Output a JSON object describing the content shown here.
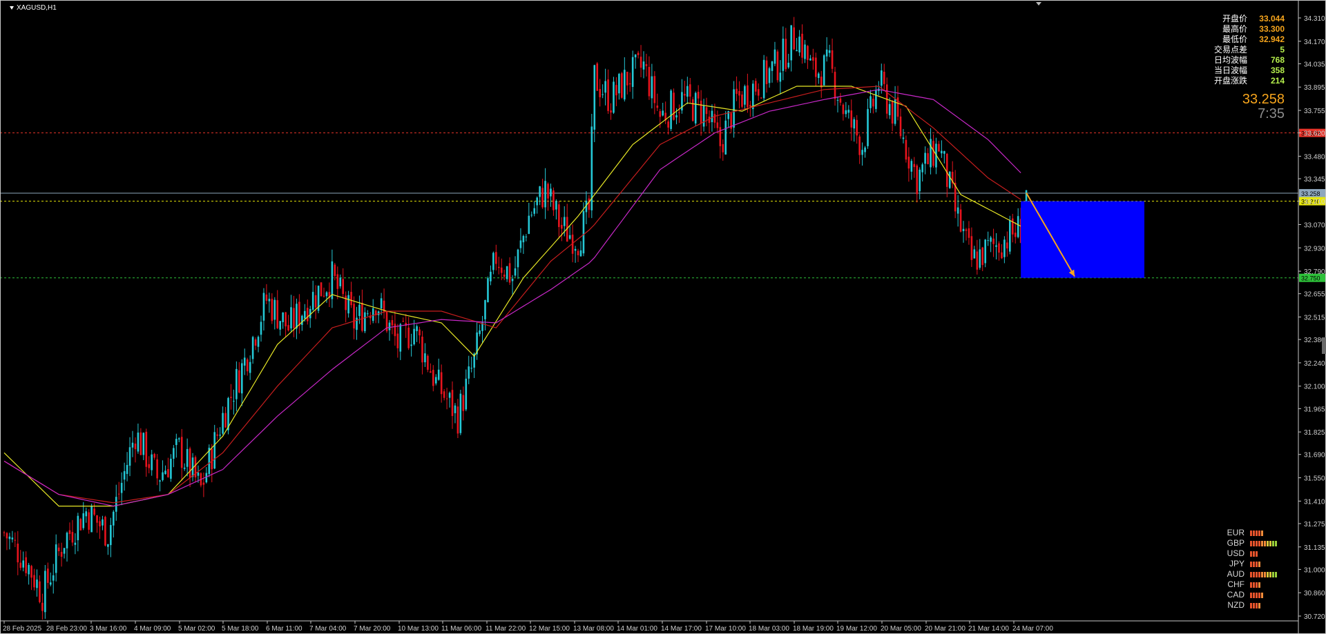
{
  "app": {
    "symbol_title": "XAGUSD,H1"
  },
  "info_panel": {
    "rows": [
      {
        "label": "开盘价",
        "value": "33.044"
      },
      {
        "label": "最高价",
        "value": "33.300"
      },
      {
        "label": "最低价",
        "value": "32.942"
      },
      {
        "label": "交易点差",
        "value": "5"
      },
      {
        "label": "日均波幅",
        "value": "768"
      },
      {
        "label": "当日波幅",
        "value": "358"
      },
      {
        "label": "开盘涨跌",
        "value": "214"
      }
    ],
    "current_price": "33.258",
    "countdown": "7:35"
  },
  "currency_strength": [
    {
      "currency": "EUR",
      "levels": 5,
      "colors": [
        "#e8542c",
        "#e8542c",
        "#e8542c",
        "#e8542c",
        "#f38d3a"
      ]
    },
    {
      "currency": "GBP",
      "levels": 10,
      "colors": [
        "#e8542c",
        "#e8542c",
        "#e8542c",
        "#e8542c",
        "#f38d3a",
        "#f38d3a",
        "#d7c53a",
        "#d7c53a",
        "#9ad13a",
        "#9ad13a"
      ]
    },
    {
      "currency": "USD",
      "levels": 3,
      "colors": [
        "#e8542c",
        "#e8542c",
        "#e8542c"
      ]
    },
    {
      "currency": "JPY",
      "levels": 4,
      "colors": [
        "#e8542c",
        "#e8542c",
        "#e8542c",
        "#f38d3a"
      ]
    },
    {
      "currency": "AUD",
      "levels": 10,
      "colors": [
        "#e8542c",
        "#e8542c",
        "#e8542c",
        "#e8542c",
        "#f38d3a",
        "#f38d3a",
        "#d7c53a",
        "#d7c53a",
        "#9ad13a",
        "#9ad13a"
      ]
    },
    {
      "currency": "CHF",
      "levels": 4,
      "colors": [
        "#e8542c",
        "#e8542c",
        "#e8542c",
        "#f38d3a"
      ]
    },
    {
      "currency": "CAD",
      "levels": 5,
      "colors": [
        "#e8542c",
        "#e8542c",
        "#e8542c",
        "#e8542c",
        "#f38d3a"
      ]
    },
    {
      "currency": "NZD",
      "levels": 4,
      "colors": [
        "#e8542c",
        "#e8542c",
        "#e8542c",
        "#f38d3a"
      ]
    }
  ],
  "chart_data": {
    "type": "candlestick",
    "symbol": "XAGUSD",
    "timeframe": "H1",
    "ylim": [
      30.72,
      34.38
    ],
    "y_ticks": [
      "34.310",
      "34.170",
      "34.035",
      "33.895",
      "33.755",
      "33.620",
      "33.480",
      "33.345",
      "33.210",
      "33.070",
      "32.930",
      "32.790",
      "32.655",
      "32.515",
      "32.380",
      "32.240",
      "32.100",
      "31.965",
      "31.825",
      "31.690",
      "31.550",
      "31.410",
      "31.275",
      "31.135",
      "31.000",
      "30.860",
      "30.720"
    ],
    "x_labels": [
      "28 Feb 2025",
      "28 Feb 23:00",
      "3 Mar 16:00",
      "4 Mar 09:00",
      "5 Mar 02:00",
      "5 Mar 18:00",
      "6 Mar 11:00",
      "7 Mar 04:00",
      "7 Mar 20:00",
      "10 Mar 13:00",
      "11 Mar 06:00",
      "11 Mar 22:00",
      "12 Mar 15:00",
      "13 Mar 08:00",
      "14 Mar 01:00",
      "14 Mar 17:00",
      "17 Mar 10:00",
      "18 Mar 03:00",
      "18 Mar 19:00",
      "19 Mar 12:00",
      "20 Mar 05:00",
      "20 Mar 21:00",
      "21 Mar 14:00",
      "24 Mar 07:00"
    ],
    "close_path": [
      [
        0,
        31.22
      ],
      [
        8,
        31.05
      ],
      [
        14,
        30.85
      ],
      [
        22,
        31.18
      ],
      [
        30,
        31.35
      ],
      [
        38,
        31.22
      ],
      [
        48,
        31.82
      ],
      [
        56,
        31.55
      ],
      [
        64,
        31.72
      ],
      [
        72,
        31.48
      ],
      [
        80,
        31.92
      ],
      [
        88,
        32.25
      ],
      [
        96,
        32.62
      ],
      [
        104,
        32.45
      ],
      [
        112,
        32.62
      ],
      [
        120,
        32.75
      ],
      [
        128,
        32.48
      ],
      [
        136,
        32.62
      ],
      [
        144,
        32.35
      ],
      [
        150,
        32.45
      ],
      [
        158,
        32.12
      ],
      [
        166,
        31.92
      ],
      [
        172,
        32.25
      ],
      [
        180,
        32.88
      ],
      [
        186,
        32.75
      ],
      [
        192,
        33.12
      ],
      [
        198,
        33.28
      ],
      [
        204,
        33.05
      ],
      [
        210,
        32.98
      ],
      [
        214,
        33.15
      ],
      [
        216,
        33.95
      ],
      [
        222,
        33.82
      ],
      [
        228,
        33.95
      ],
      [
        234,
        34.02
      ],
      [
        240,
        33.72
      ],
      [
        248,
        33.82
      ],
      [
        256,
        33.75
      ],
      [
        262,
        33.55
      ],
      [
        268,
        33.82
      ],
      [
        276,
        33.92
      ],
      [
        284,
        34.05
      ],
      [
        290,
        34.22
      ],
      [
        296,
        33.98
      ],
      [
        302,
        34.02
      ],
      [
        308,
        33.72
      ],
      [
        314,
        33.55
      ],
      [
        320,
        33.92
      ],
      [
        326,
        33.72
      ],
      [
        334,
        33.35
      ],
      [
        342,
        33.55
      ],
      [
        348,
        33.15
      ],
      [
        354,
        32.85
      ],
      [
        360,
        32.92
      ],
      [
        366,
        32.98
      ],
      [
        372,
        33.05
      ],
      [
        374,
        33.26
      ]
    ],
    "ma_fast": [
      [
        0,
        31.7
      ],
      [
        20,
        31.38
      ],
      [
        40,
        31.38
      ],
      [
        60,
        31.45
      ],
      [
        80,
        31.8
      ],
      [
        100,
        32.35
      ],
      [
        120,
        32.65
      ],
      [
        140,
        32.55
      ],
      [
        160,
        32.48
      ],
      [
        172,
        32.28
      ],
      [
        190,
        32.75
      ],
      [
        210,
        33.12
      ],
      [
        230,
        33.55
      ],
      [
        250,
        33.8
      ],
      [
        270,
        33.75
      ],
      [
        290,
        33.9
      ],
      [
        310,
        33.9
      ],
      [
        330,
        33.78
      ],
      [
        350,
        33.25
      ],
      [
        372,
        33.06
      ]
    ],
    "ma_mid": [
      [
        0,
        31.65
      ],
      [
        20,
        31.45
      ],
      [
        40,
        31.4
      ],
      [
        60,
        31.45
      ],
      [
        80,
        31.7
      ],
      [
        100,
        32.1
      ],
      [
        120,
        32.45
      ],
      [
        140,
        32.55
      ],
      [
        160,
        32.55
      ],
      [
        180,
        32.45
      ],
      [
        200,
        32.85
      ],
      [
        215,
        33.05
      ],
      [
        240,
        33.55
      ],
      [
        260,
        33.72
      ],
      [
        280,
        33.8
      ],
      [
        300,
        33.88
      ],
      [
        320,
        33.9
      ],
      [
        340,
        33.65
      ],
      [
        360,
        33.35
      ],
      [
        372,
        33.22
      ]
    ],
    "ma_slow": [
      [
        0,
        31.65
      ],
      [
        20,
        31.45
      ],
      [
        40,
        31.38
      ],
      [
        60,
        31.45
      ],
      [
        80,
        31.6
      ],
      [
        100,
        31.92
      ],
      [
        120,
        32.2
      ],
      [
        140,
        32.45
      ],
      [
        160,
        32.5
      ],
      [
        180,
        32.48
      ],
      [
        200,
        32.68
      ],
      [
        215,
        32.85
      ],
      [
        240,
        33.4
      ],
      [
        260,
        33.62
      ],
      [
        280,
        33.75
      ],
      [
        300,
        33.82
      ],
      [
        320,
        33.88
      ],
      [
        340,
        33.82
      ],
      [
        360,
        33.58
      ],
      [
        372,
        33.38
      ]
    ],
    "levels": [
      {
        "name": "resistance",
        "price": 33.62,
        "label": "33.620",
        "color": "#e8342a"
      },
      {
        "name": "bid",
        "price": 33.258,
        "label": "33.258",
        "color": "#8ea7bd"
      },
      {
        "name": "entry",
        "price": 33.21,
        "label": "33.210",
        "color": "#e8e80a"
      },
      {
        "name": "target",
        "price": 32.75,
        "label": "32.750",
        "color": "#2ec23a"
      }
    ],
    "target_zone": {
      "price_top": 33.21,
      "price_bottom": 32.75,
      "color": "#0000ff"
    },
    "colors": {
      "bull": "#25c8d6",
      "bear": "#e8141e",
      "ma_fast": "#e8e826",
      "ma_mid": "#c81e1e",
      "ma_slow": "#c828c8",
      "arrow": "#f7a51c"
    }
  }
}
